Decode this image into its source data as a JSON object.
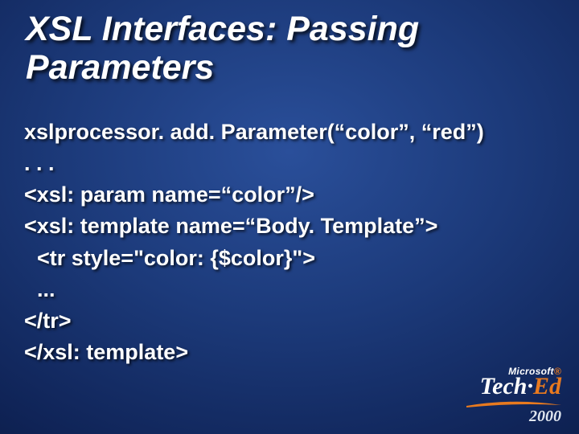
{
  "title_line1": "XSL Interfaces: Passing",
  "title_line2": "Parameters",
  "code": {
    "l1": "xslprocessor. add. Parameter(“color”, “red”)",
    "l2": ". . .",
    "l3": "<xsl: param name=“color”/>",
    "l4": "<xsl: template name=“Body. Template”>",
    "l5": "<tr style=\"color: {$color}\">",
    "l6": "...",
    "l7": "</tr>",
    "l8": "</xsl: template>"
  },
  "logo": {
    "ms_prefix": "Microsoft",
    "brand_pre": "Tech·",
    "brand_orange": "Ed",
    "year": "2000"
  }
}
